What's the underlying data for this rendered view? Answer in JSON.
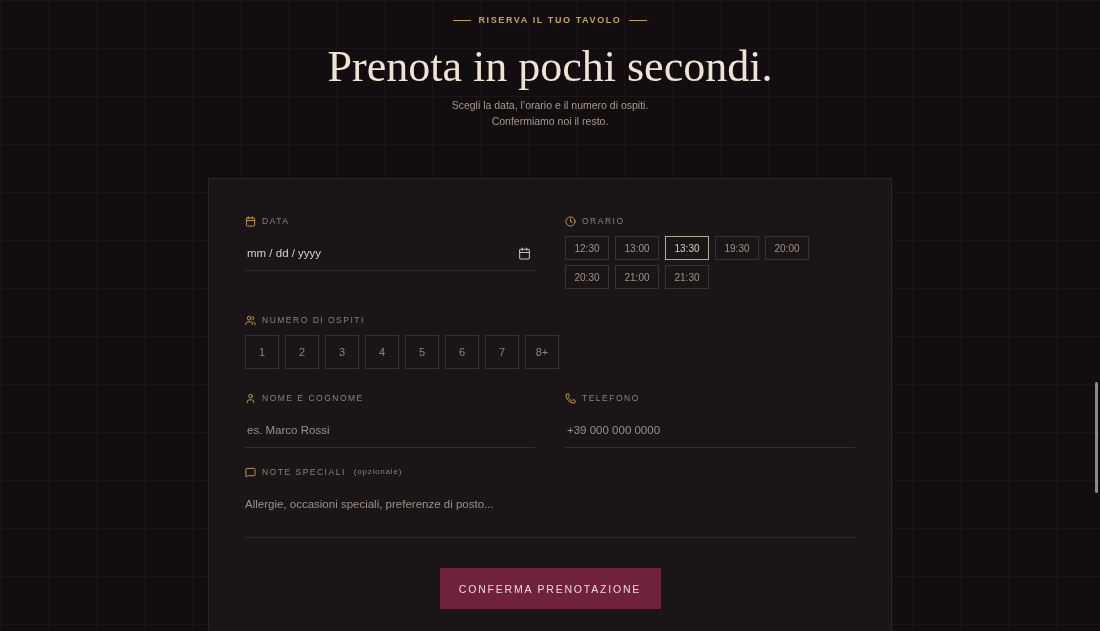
{
  "header": {
    "eyebrow": "RISERVA IL TUO TAVOLO",
    "title": "Prenota in pochi secondi.",
    "subtitle": [
      "Scegli la data, l’orario e il numero di ospiti.",
      "Confermiamo noi il resto."
    ]
  },
  "form": {
    "date": {
      "label": "DATA",
      "placeholder": "mm / dd / yyyy"
    },
    "time": {
      "label": "ORARIO",
      "slots": [
        {
          "label": "12:30",
          "selected": false
        },
        {
          "label": "13:00",
          "selected": false
        },
        {
          "label": "13:30",
          "selected": true
        },
        {
          "label": "19:30",
          "selected": false
        },
        {
          "label": "20:00",
          "selected": false
        },
        {
          "label": "20:30",
          "selected": false
        },
        {
          "label": "21:00",
          "selected": false
        },
        {
          "label": "21:30",
          "selected": false
        }
      ]
    },
    "guests": {
      "label": "NUMERO DI OSPITI",
      "options": [
        {
          "label": "1",
          "selected": false
        },
        {
          "label": "2",
          "selected": false
        },
        {
          "label": "3",
          "selected": false
        },
        {
          "label": "4",
          "selected": false
        },
        {
          "label": "5",
          "selected": false
        },
        {
          "label": "6",
          "selected": false
        },
        {
          "label": "7",
          "selected": false
        },
        {
          "label": "8+",
          "selected": false
        }
      ]
    },
    "name": {
      "label": "NOME E COGNOME",
      "placeholder": "es. Marco Rossi"
    },
    "phone": {
      "label": "TELEFONO",
      "placeholder": "+39 000 000 0000"
    },
    "notes": {
      "label": "NOTE SPECIALI",
      "hint": "(opzionale)",
      "placeholder": "Allergie, occasioni speciali, preferenze di posto..."
    },
    "submit": "CONFERMA PRENOTAZIONE"
  }
}
